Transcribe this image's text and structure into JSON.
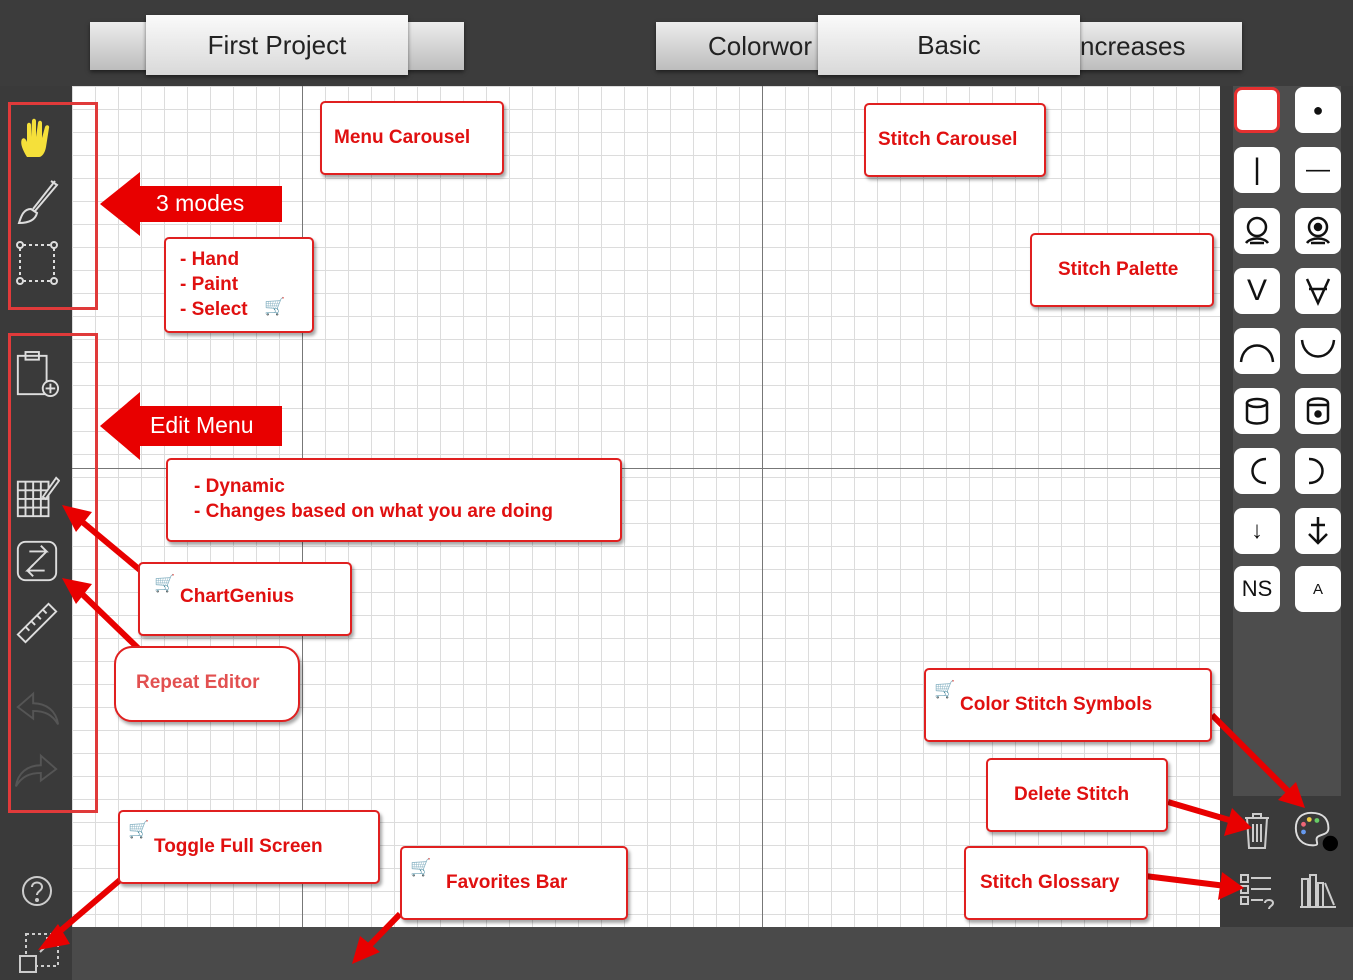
{
  "menu_carousel": {
    "tabs": [
      {
        "label": ""
      },
      {
        "label": "First Project"
      },
      {
        "label": ""
      }
    ]
  },
  "stitch_carousel": {
    "tabs": [
      {
        "label": "Colorwor"
      },
      {
        "label": "Basic"
      },
      {
        "label": "ncreases"
      }
    ]
  },
  "modes": [
    {
      "name": "hand-icon"
    },
    {
      "name": "brush-icon"
    },
    {
      "name": "select-icon"
    }
  ],
  "edit_menu": [
    {
      "name": "clipboard-add-icon"
    },
    {
      "name": "chart-edit-icon"
    },
    {
      "name": "repeat-icon"
    },
    {
      "name": "ruler-icon"
    },
    {
      "name": "undo-icon"
    },
    {
      "name": "redo-icon"
    }
  ],
  "stitches": [
    {
      "symbol": "",
      "name": "blank"
    },
    {
      "symbol": "●",
      "name": "dot"
    },
    {
      "symbol": "|",
      "name": "vertical-bar"
    },
    {
      "symbol": "—",
      "name": "horizontal-bar"
    },
    {
      "symbol": "",
      "name": "loop"
    },
    {
      "symbol": "",
      "name": "loop-dot"
    },
    {
      "symbol": "V",
      "name": "v"
    },
    {
      "symbol": "",
      "name": "v-bar"
    },
    {
      "symbol": "",
      "name": "arc-up"
    },
    {
      "symbol": "",
      "name": "arc-down"
    },
    {
      "symbol": "",
      "name": "cylinder"
    },
    {
      "symbol": "",
      "name": "cylinder-dot"
    },
    {
      "symbol": "",
      "name": "left-c"
    },
    {
      "symbol": "",
      "name": "right-c"
    },
    {
      "symbol": "↓",
      "name": "arrow-down"
    },
    {
      "symbol": "",
      "name": "arrow-down-bar"
    },
    {
      "symbol": "NS",
      "name": "ns"
    },
    {
      "symbol": "A",
      "name": "a"
    }
  ],
  "callouts": {
    "menu_carousel": "Menu Carousel",
    "stitch_carousel": "Stitch Carousel",
    "three_modes": "3 modes",
    "modes_list": "- Hand\n- Paint\n- Select",
    "stitch_palette": "Stitch Palette",
    "edit_menu": "Edit Menu",
    "dynamic": "- Dynamic\n- Changes based on what you are doing",
    "chartgenius": "ChartGenius",
    "repeat_editor": "Repeat Editor",
    "color_stitch_symbols": "Color Stitch Symbols",
    "delete_stitch": "Delete Stitch",
    "stitch_glossary": "Stitch Glossary",
    "toggle_full_screen": "Toggle Full Screen",
    "favorites_bar": "Favorites Bar"
  },
  "colors": {
    "accent_red": "#e02020",
    "hand_yellow": "#f5e03a",
    "toolbar_bg": "#3a3a3a"
  }
}
